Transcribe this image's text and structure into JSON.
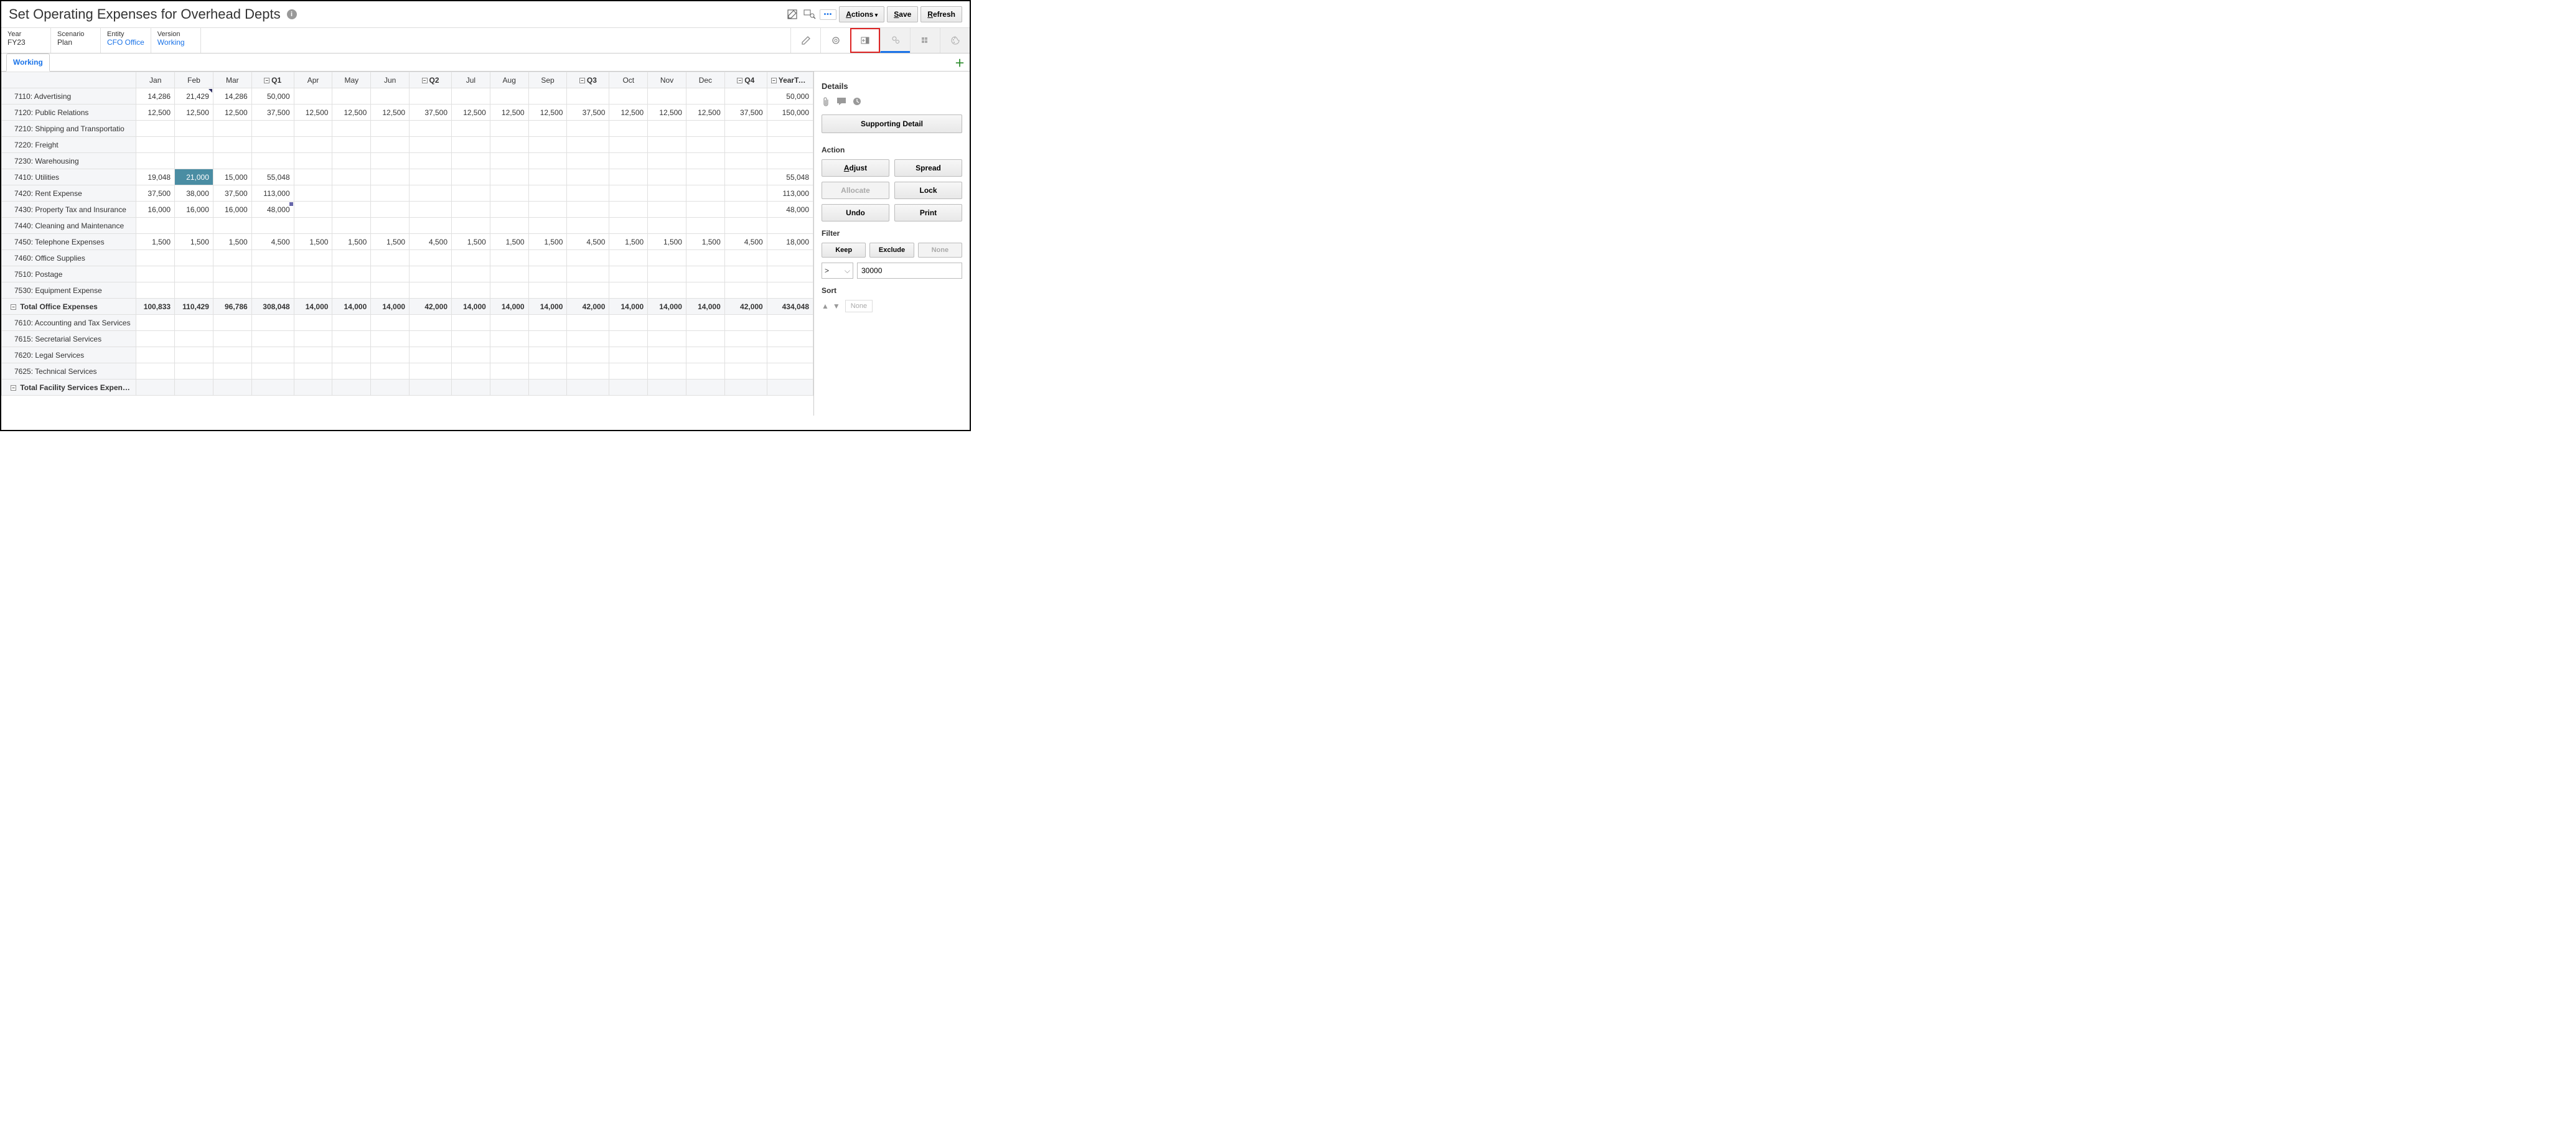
{
  "header": {
    "title": "Set Operating Expenses for Overhead Depts",
    "actions_label": "Actions",
    "save_label": "Save",
    "refresh_label": "Refresh"
  },
  "pov": {
    "year_label": "Year",
    "year_value": "FY23",
    "scenario_label": "Scenario",
    "scenario_value": "Plan",
    "entity_label": "Entity",
    "entity_value": "CFO Office",
    "version_label": "Version",
    "version_value": "Working"
  },
  "tabs": {
    "working": "Working"
  },
  "columns": {
    "jan": "Jan",
    "feb": "Feb",
    "mar": "Mar",
    "q1": "Q1",
    "apr": "Apr",
    "may": "May",
    "jun": "Jun",
    "q2": "Q2",
    "jul": "Jul",
    "aug": "Aug",
    "sep": "Sep",
    "q3": "Q3",
    "oct": "Oct",
    "nov": "Nov",
    "dec": "Dec",
    "q4": "Q4",
    "yeartotal": "YearTotal"
  },
  "rows": [
    {
      "label": "7110: Advertising",
      "v": [
        "14,286",
        "21,429",
        "14,286",
        "50,000",
        "",
        "",
        "",
        "",
        "",
        "",
        "",
        "",
        "",
        "",
        "",
        "",
        "50,000"
      ],
      "dirty": [
        2
      ]
    },
    {
      "label": "7120: Public Relations",
      "v": [
        "12,500",
        "12,500",
        "12,500",
        "37,500",
        "12,500",
        "12,500",
        "12,500",
        "37,500",
        "12,500",
        "12,500",
        "12,500",
        "37,500",
        "12,500",
        "12,500",
        "12,500",
        "37,500",
        "150,000"
      ]
    },
    {
      "label": "7210: Shipping and Transportatio",
      "v": [
        "",
        "",
        "",
        "",
        "",
        "",
        "",
        "",
        "",
        "",
        "",
        "",
        "",
        "",
        "",
        "",
        ""
      ]
    },
    {
      "label": "7220: Freight",
      "v": [
        "",
        "",
        "",
        "",
        "",
        "",
        "",
        "",
        "",
        "",
        "",
        "",
        "",
        "",
        "",
        "",
        ""
      ]
    },
    {
      "label": "7230: Warehousing",
      "v": [
        "",
        "",
        "",
        "",
        "",
        "",
        "",
        "",
        "",
        "",
        "",
        "",
        "",
        "",
        "",
        "",
        ""
      ]
    },
    {
      "label": "7410: Utilities",
      "v": [
        "19,048",
        "21,000",
        "15,000",
        "55,048",
        "",
        "",
        "",
        "",
        "",
        "",
        "",
        "",
        "",
        "",
        "",
        "",
        "55,048"
      ],
      "sel": [
        2
      ]
    },
    {
      "label": "7420: Rent Expense",
      "v": [
        "37,500",
        "38,000",
        "37,500",
        "113,000",
        "",
        "",
        "",
        "",
        "",
        "",
        "",
        "",
        "",
        "",
        "",
        "",
        "113,000"
      ]
    },
    {
      "label": "7430: Property Tax and Insurance",
      "v": [
        "16,000",
        "16,000",
        "16,000",
        "48,000",
        "",
        "",
        "",
        "",
        "",
        "",
        "",
        "",
        "",
        "",
        "",
        "",
        "48,000"
      ],
      "sd": [
        4
      ]
    },
    {
      "label": "7440: Cleaning and Maintenance",
      "v": [
        "",
        "",
        "",
        "",
        "",
        "",
        "",
        "",
        "",
        "",
        "",
        "",
        "",
        "",
        "",
        "",
        ""
      ]
    },
    {
      "label": "7450: Telephone Expenses",
      "v": [
        "1,500",
        "1,500",
        "1,500",
        "4,500",
        "1,500",
        "1,500",
        "1,500",
        "4,500",
        "1,500",
        "1,500",
        "1,500",
        "4,500",
        "1,500",
        "1,500",
        "1,500",
        "4,500",
        "18,000"
      ]
    },
    {
      "label": "7460: Office Supplies",
      "v": [
        "",
        "",
        "",
        "",
        "",
        "",
        "",
        "",
        "",
        "",
        "",
        "",
        "",
        "",
        "",
        "",
        ""
      ]
    },
    {
      "label": "7510: Postage",
      "v": [
        "",
        "",
        "",
        "",
        "",
        "",
        "",
        "",
        "",
        "",
        "",
        "",
        "",
        "",
        "",
        "",
        ""
      ]
    },
    {
      "label": "7530: Equipment Expense",
      "v": [
        "",
        "",
        "",
        "",
        "",
        "",
        "",
        "",
        "",
        "",
        "",
        "",
        "",
        "",
        "",
        "",
        ""
      ]
    },
    {
      "label": "Total Office Expenses",
      "total": true,
      "v": [
        "100,833",
        "110,429",
        "96,786",
        "308,048",
        "14,000",
        "14,000",
        "14,000",
        "42,000",
        "14,000",
        "14,000",
        "14,000",
        "42,000",
        "14,000",
        "14,000",
        "14,000",
        "42,000",
        "434,048"
      ]
    },
    {
      "label": "7610: Accounting and Tax Services",
      "v": [
        "",
        "",
        "",
        "",
        "",
        "",
        "",
        "",
        "",
        "",
        "",
        "",
        "",
        "",
        "",
        "",
        ""
      ]
    },
    {
      "label": "7615: Secretarial Services",
      "v": [
        "",
        "",
        "",
        "",
        "",
        "",
        "",
        "",
        "",
        "",
        "",
        "",
        "",
        "",
        "",
        "",
        ""
      ]
    },
    {
      "label": "7620: Legal Services",
      "v": [
        "",
        "",
        "",
        "",
        "",
        "",
        "",
        "",
        "",
        "",
        "",
        "",
        "",
        "",
        "",
        "",
        ""
      ]
    },
    {
      "label": "7625: Technical Services",
      "v": [
        "",
        "",
        "",
        "",
        "",
        "",
        "",
        "",
        "",
        "",
        "",
        "",
        "",
        "",
        "",
        "",
        ""
      ]
    },
    {
      "label": "Total Facility Services Expenses",
      "total": true,
      "v": [
        "",
        "",
        "",
        "",
        "",
        "",
        "",
        "",
        "",
        "",
        "",
        "",
        "",
        "",
        "",
        "",
        ""
      ]
    }
  ],
  "panel": {
    "details_heading": "Details",
    "supporting_detail": "Supporting Detail",
    "action_heading": "Action",
    "adjust": "Adjust",
    "spread": "Spread",
    "allocate": "Allocate",
    "lock": "Lock",
    "undo": "Undo",
    "print": "Print",
    "filter_heading": "Filter",
    "keep": "Keep",
    "exclude": "Exclude",
    "none": "None",
    "filter_op": ">",
    "filter_value": "30000",
    "sort_heading": "Sort",
    "sort_none": "None"
  }
}
